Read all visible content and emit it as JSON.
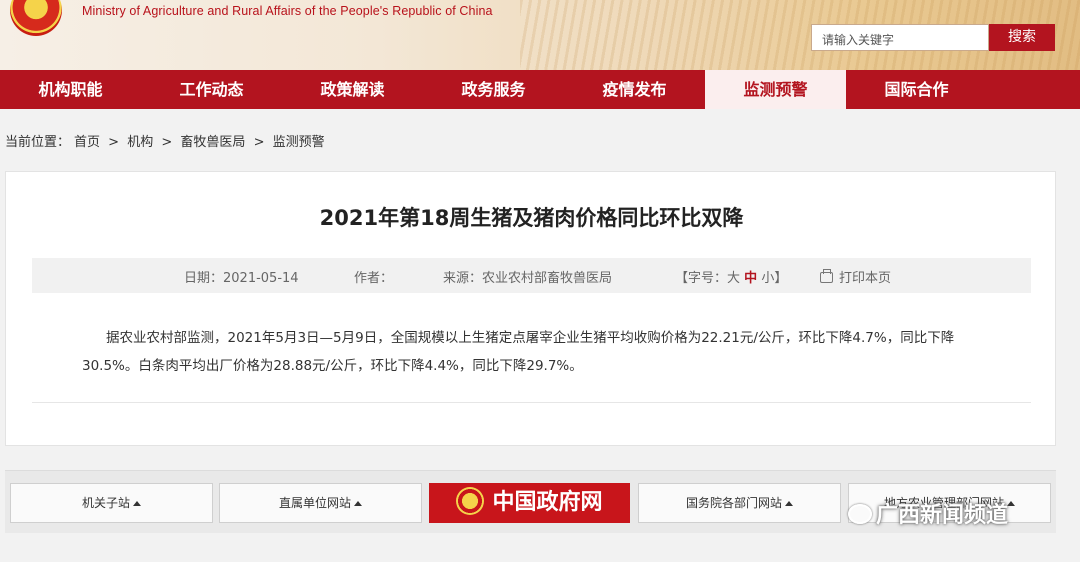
{
  "header": {
    "ministry_en": "Ministry of Agriculture and Rural Affairs  of the People's Republic of China",
    "search_placeholder": "请输入关键字",
    "search_button": "搜索"
  },
  "nav": [
    {
      "label": "机构职能",
      "active": false
    },
    {
      "label": "工作动态",
      "active": false
    },
    {
      "label": "政策解读",
      "active": false
    },
    {
      "label": "政务服务",
      "active": false
    },
    {
      "label": "疫情发布",
      "active": false
    },
    {
      "label": "监测预警",
      "active": true
    },
    {
      "label": "国际合作",
      "active": false
    }
  ],
  "breadcrumb": {
    "prefix": "当前位置：",
    "items": [
      "首页",
      "机构",
      "畜牧兽医局",
      "监测预警"
    ],
    "separator": ">"
  },
  "article": {
    "title": "2021年第18周生猪及猪肉价格同比环比双降",
    "date": "日期：2021-05-14",
    "author": "作者：",
    "source": "来源：农业农村部畜牧兽医局",
    "font_size_label_start": "【字号：",
    "font_size_large": "大",
    "font_size_medium": "中",
    "font_size_small": "小",
    "font_size_label_end": "】",
    "print": "打印本页",
    "body_line1": "据农业农村部监测，2021年5月3日—5月9日，全国规模以上生猪定点屠宰企业生猪平均收购价格为22.21元/公斤，环比下降4.7%，同比下降",
    "body_line2": "30.5%。白条肉平均出厂价格为28.88元/公斤，环比下降4.4%，同比下降29.7%。"
  },
  "footer": {
    "links": [
      "机关子站",
      "直属单位网站",
      "国务院各部门网站",
      "地方农业管理部门网站"
    ],
    "gov_logo_text": "中国政府网",
    "watermark": "广西新闻频道"
  },
  "colors": {
    "brand_red": "#b3141f",
    "nav_active_bg": "#fbeeee"
  }
}
